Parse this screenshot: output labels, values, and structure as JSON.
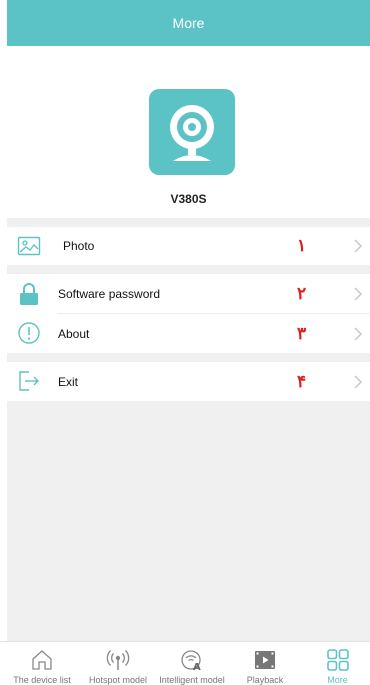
{
  "header": {
    "title": "More"
  },
  "profile": {
    "device_name": "V380S",
    "logo_icon": "camera-logo-icon"
  },
  "menu": [
    {
      "label": "Photo",
      "number": "۱",
      "icon": "image-icon"
    },
    {
      "label": "Software password",
      "number": "۲",
      "icon": "lock-icon"
    },
    {
      "label": "About",
      "number": "۳",
      "icon": "info-icon"
    },
    {
      "label": "Exit",
      "number": "۴",
      "icon": "exit-icon"
    }
  ],
  "tabs": [
    {
      "label": "The device list",
      "icon": "home-icon"
    },
    {
      "label": "Hotspot model",
      "icon": "hotspot-icon"
    },
    {
      "label": "Intelligent model",
      "icon": "intelligent-icon"
    },
    {
      "label": "Playback",
      "icon": "playback-icon"
    },
    {
      "label": "More",
      "icon": "grid-icon",
      "active": true
    }
  ],
  "colors": {
    "accent": "#5bc3c6",
    "annotation": "#e0201c"
  }
}
